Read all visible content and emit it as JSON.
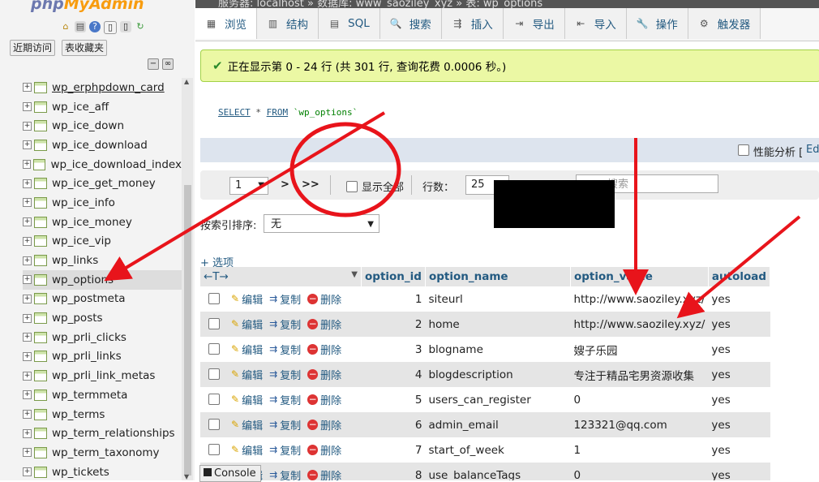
{
  "logo": {
    "text_1": "php",
    "text_2": "MyAdmin"
  },
  "left_buttons": {
    "recent": "近期访问",
    "favorites": "表收藏夹"
  },
  "tree_items": [
    {
      "label": "wp_erphpdown_card"
    },
    {
      "label": "wp_ice_aff"
    },
    {
      "label": "wp_ice_down"
    },
    {
      "label": "wp_ice_download"
    },
    {
      "label": "wp_ice_download_index"
    },
    {
      "label": "wp_ice_get_money"
    },
    {
      "label": "wp_ice_info"
    },
    {
      "label": "wp_ice_money"
    },
    {
      "label": "wp_ice_vip"
    },
    {
      "label": "wp_links"
    },
    {
      "label": "wp_options"
    },
    {
      "label": "wp_postmeta"
    },
    {
      "label": "wp_posts"
    },
    {
      "label": "wp_prli_clicks"
    },
    {
      "label": "wp_prli_links"
    },
    {
      "label": "wp_prli_link_metas"
    },
    {
      "label": "wp_termmeta"
    },
    {
      "label": "wp_terms"
    },
    {
      "label": "wp_term_relationships"
    },
    {
      "label": "wp_term_taxonomy"
    },
    {
      "label": "wp_tickets"
    }
  ],
  "breadcrumb": "服务器: localhost » 数据库: www_saoziley_xyz » 表: wp_options",
  "tabs": [
    {
      "label": "浏览",
      "icon": "▦"
    },
    {
      "label": "结构",
      "icon": "▥"
    },
    {
      "label": "SQL",
      "icon": "▤"
    },
    {
      "label": "搜索",
      "icon": "🔍"
    },
    {
      "label": "插入",
      "icon": "⇶"
    },
    {
      "label": "导出",
      "icon": "⇥"
    },
    {
      "label": "导入",
      "icon": "⇤"
    },
    {
      "label": "操作",
      "icon": "🔧"
    },
    {
      "label": "触发器",
      "icon": "⚙"
    }
  ],
  "success_message": "正在显示第 0 - 24 行 (共 301 行, 查询花费 0.0006 秒。)",
  "sql": {
    "keyword_1": "SELECT",
    "middle": " * ",
    "keyword_2": "FROM",
    "table": " `wp_options`"
  },
  "profiling": {
    "label": "性能分析 [",
    "edit": "Ed"
  },
  "nav": {
    "page": "1",
    "next": ">",
    "last": ">>",
    "show_all": "显示全部",
    "rows_label": "行数：",
    "rows_value": "25",
    "filter_placeholder": "搜索"
  },
  "sort": {
    "label": "按索引排序:",
    "value": "无"
  },
  "options_link": "+ 选项",
  "columns": [
    "option_id",
    "option_name",
    "option_value",
    "autoload"
  ],
  "actions": {
    "edit": "编辑",
    "copy": "复制",
    "delete": "删除"
  },
  "rows": [
    {
      "id": "1",
      "name": "siteurl",
      "value": "http://www.saoziley.xyz/",
      "autoload": "yes"
    },
    {
      "id": "2",
      "name": "home",
      "value": "http://www.saoziley.xyz/",
      "autoload": "yes"
    },
    {
      "id": "3",
      "name": "blogname",
      "value": "嫂子乐园",
      "autoload": "yes"
    },
    {
      "id": "4",
      "name": "blogdescription",
      "value": "专注于精品宅男资源收集",
      "autoload": "yes"
    },
    {
      "id": "5",
      "name": "users_can_register",
      "value": "0",
      "autoload": "yes"
    },
    {
      "id": "6",
      "name": "admin_email",
      "value": "123321@qq.com",
      "autoload": "yes"
    },
    {
      "id": "7",
      "name": "start_of_week",
      "value": "1",
      "autoload": "yes"
    },
    {
      "id": "8",
      "name": "use_balanceTags",
      "value": "0",
      "autoload": "yes"
    }
  ],
  "console": "Console",
  "annotation_color": "#e8141b"
}
